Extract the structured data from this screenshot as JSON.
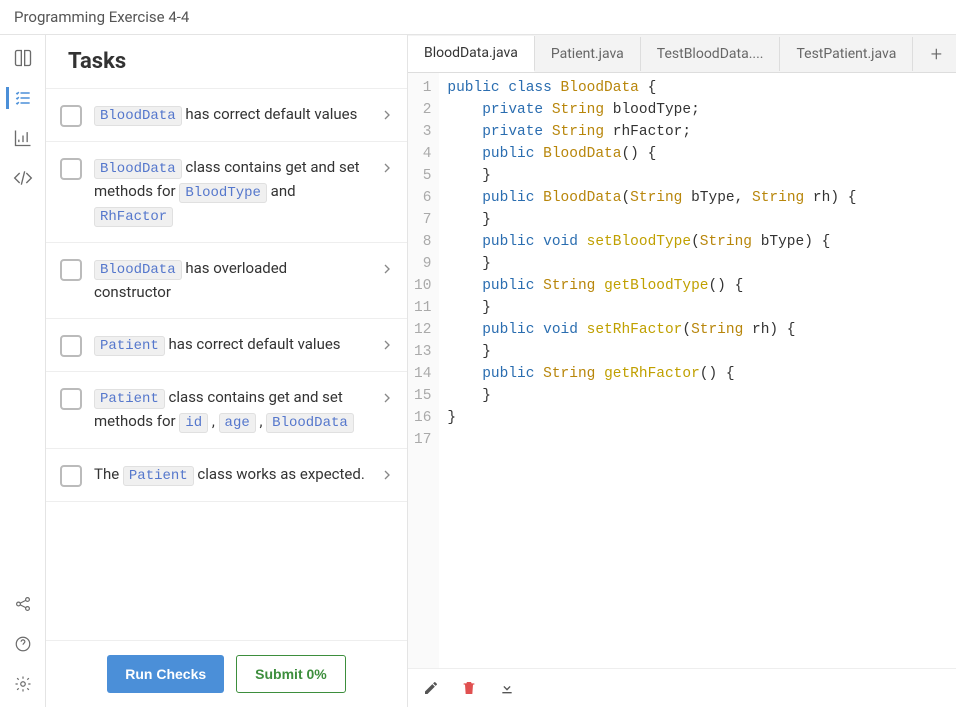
{
  "header": {
    "title": "Programming Exercise 4-4"
  },
  "tasks": {
    "heading": "Tasks",
    "items": [
      {
        "parts": [
          {
            "code": "BloodData"
          },
          {
            "text": " has correct default values"
          }
        ]
      },
      {
        "parts": [
          {
            "code": "BloodData"
          },
          {
            "text": " class contains get and set methods for "
          },
          {
            "code": "BloodType"
          },
          {
            "text": " and "
          },
          {
            "code": "RhFactor"
          }
        ]
      },
      {
        "parts": [
          {
            "code": "BloodData"
          },
          {
            "text": " has overloaded constructor"
          }
        ]
      },
      {
        "parts": [
          {
            "code": "Patient"
          },
          {
            "text": " has correct default values"
          }
        ]
      },
      {
        "parts": [
          {
            "code": "Patient"
          },
          {
            "text": " class contains get and set methods for "
          },
          {
            "code": "id"
          },
          {
            "text": " , "
          },
          {
            "code": "age"
          },
          {
            "text": " , "
          },
          {
            "code": "BloodData"
          }
        ]
      },
      {
        "parts": [
          {
            "text": "The "
          },
          {
            "code": "Patient"
          },
          {
            "text": " class works as expected."
          }
        ]
      }
    ],
    "run_label": "Run Checks",
    "submit_label": "Submit 0%"
  },
  "editor": {
    "tabs": [
      {
        "label": "BloodData.java",
        "active": true
      },
      {
        "label": "Patient.java",
        "active": false
      },
      {
        "label": "TestBloodData....",
        "active": false
      },
      {
        "label": "TestPatient.java",
        "active": false
      }
    ],
    "code": [
      [
        {
          "t": "kw",
          "v": "public"
        },
        {
          "t": "sp",
          "v": " "
        },
        {
          "t": "kw",
          "v": "class"
        },
        {
          "t": "sp",
          "v": " "
        },
        {
          "t": "type",
          "v": "BloodData"
        },
        {
          "t": "sp",
          "v": " {"
        }
      ],
      [
        {
          "t": "in",
          "v": "    "
        },
        {
          "t": "kw",
          "v": "private"
        },
        {
          "t": "sp",
          "v": " "
        },
        {
          "t": "type",
          "v": "String"
        },
        {
          "t": "sp",
          "v": " bloodType;"
        }
      ],
      [
        {
          "t": "in",
          "v": "    "
        },
        {
          "t": "kw",
          "v": "private"
        },
        {
          "t": "sp",
          "v": " "
        },
        {
          "t": "type",
          "v": "String"
        },
        {
          "t": "sp",
          "v": " rhFactor;"
        }
      ],
      [
        {
          "t": "in",
          "v": "    "
        },
        {
          "t": "kw",
          "v": "public"
        },
        {
          "t": "sp",
          "v": " "
        },
        {
          "t": "type",
          "v": "BloodData"
        },
        {
          "t": "sp",
          "v": "() {"
        }
      ],
      [
        {
          "t": "in",
          "v": "    }"
        }
      ],
      [
        {
          "t": "in",
          "v": "    "
        },
        {
          "t": "kw",
          "v": "public"
        },
        {
          "t": "sp",
          "v": " "
        },
        {
          "t": "type",
          "v": "BloodData"
        },
        {
          "t": "sp",
          "v": "("
        },
        {
          "t": "type",
          "v": "String"
        },
        {
          "t": "sp",
          "v": " bType, "
        },
        {
          "t": "type",
          "v": "String"
        },
        {
          "t": "sp",
          "v": " rh) {"
        }
      ],
      [
        {
          "t": "in",
          "v": "    }"
        }
      ],
      [
        {
          "t": "in",
          "v": "    "
        },
        {
          "t": "kw",
          "v": "public"
        },
        {
          "t": "sp",
          "v": " "
        },
        {
          "t": "kw",
          "v": "void"
        },
        {
          "t": "sp",
          "v": " "
        },
        {
          "t": "method",
          "v": "setBloodType"
        },
        {
          "t": "sp",
          "v": "("
        },
        {
          "t": "type",
          "v": "String"
        },
        {
          "t": "sp",
          "v": " bType) {"
        }
      ],
      [
        {
          "t": "in",
          "v": "    }"
        }
      ],
      [
        {
          "t": "in",
          "v": "    "
        },
        {
          "t": "kw",
          "v": "public"
        },
        {
          "t": "sp",
          "v": " "
        },
        {
          "t": "type",
          "v": "String"
        },
        {
          "t": "sp",
          "v": " "
        },
        {
          "t": "method",
          "v": "getBloodType"
        },
        {
          "t": "sp",
          "v": "() {"
        }
      ],
      [
        {
          "t": "in",
          "v": "    }"
        }
      ],
      [
        {
          "t": "in",
          "v": "    "
        },
        {
          "t": "kw",
          "v": "public"
        },
        {
          "t": "sp",
          "v": " "
        },
        {
          "t": "kw",
          "v": "void"
        },
        {
          "t": "sp",
          "v": " "
        },
        {
          "t": "method",
          "v": "setRhFactor"
        },
        {
          "t": "sp",
          "v": "("
        },
        {
          "t": "type",
          "v": "String"
        },
        {
          "t": "sp",
          "v": " rh) {"
        }
      ],
      [
        {
          "t": "in",
          "v": "    }"
        }
      ],
      [
        {
          "t": "in",
          "v": "    "
        },
        {
          "t": "kw",
          "v": "public"
        },
        {
          "t": "sp",
          "v": " "
        },
        {
          "t": "type",
          "v": "String"
        },
        {
          "t": "sp",
          "v": " "
        },
        {
          "t": "method",
          "v": "getRhFactor"
        },
        {
          "t": "sp",
          "v": "() {"
        }
      ],
      [
        {
          "t": "in",
          "v": "    }"
        }
      ],
      [
        {
          "t": "sp",
          "v": "}"
        }
      ],
      [
        {
          "t": "sp",
          "v": ""
        }
      ]
    ]
  }
}
